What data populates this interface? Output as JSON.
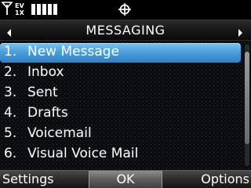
{
  "status_bar": {
    "icons": [
      "signal-antenna-icon",
      "ev-1x-data-icon",
      "signal-strength-bars-icon",
      "gps-location-icon"
    ]
  },
  "title_bar": {
    "title": "MESSAGING",
    "left_arrow": "◂",
    "right_arrow": "▸"
  },
  "menu": {
    "selected_index": 0,
    "items": [
      {
        "number": "1.",
        "label": "New Message"
      },
      {
        "number": "2.",
        "label": "Inbox"
      },
      {
        "number": "3.",
        "label": "Sent"
      },
      {
        "number": "4.",
        "label": "Drafts"
      },
      {
        "number": "5.",
        "label": "Voicemail"
      },
      {
        "number": "6.",
        "label": "Visual Voice Mail"
      }
    ]
  },
  "softkeys": {
    "left": "Settings",
    "center": "OK",
    "right": "Options"
  },
  "colors": {
    "highlight": "#4a9fdc",
    "background": "#000000"
  }
}
